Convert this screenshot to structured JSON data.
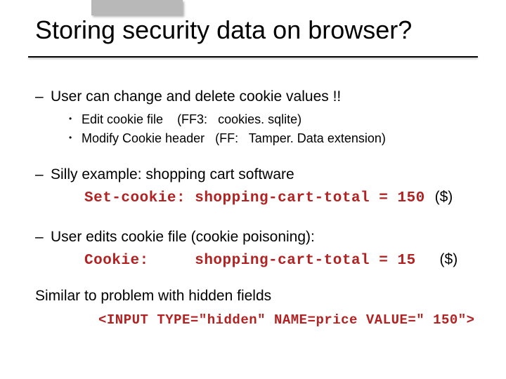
{
  "title": "Storing security data on browser?",
  "p1": {
    "marker": "–",
    "text": "User can change and delete cookie values !!",
    "sub": [
      {
        "marker": "•",
        "text": "Edit cookie file    (FF3:   cookies. sqlite)"
      },
      {
        "marker": "•",
        "text": "Modify Cookie header   (FF:   Tamper. Data extension)"
      }
    ]
  },
  "p2": {
    "marker": "–",
    "text": "Silly example: shopping cart software",
    "code": "Set-cookie: shopping-cart-total = 150",
    "paren": "($)"
  },
  "p3": {
    "marker": "–",
    "text": "User edits cookie file  (cookie poisoning):",
    "code": "Cookie:     shopping-cart-total = 15",
    "paren": "($)"
  },
  "p4": "Similar to problem with hidden fields",
  "p4_code": "<INPUT TYPE=\"hidden\" NAME=price VALUE=\" 150\">"
}
